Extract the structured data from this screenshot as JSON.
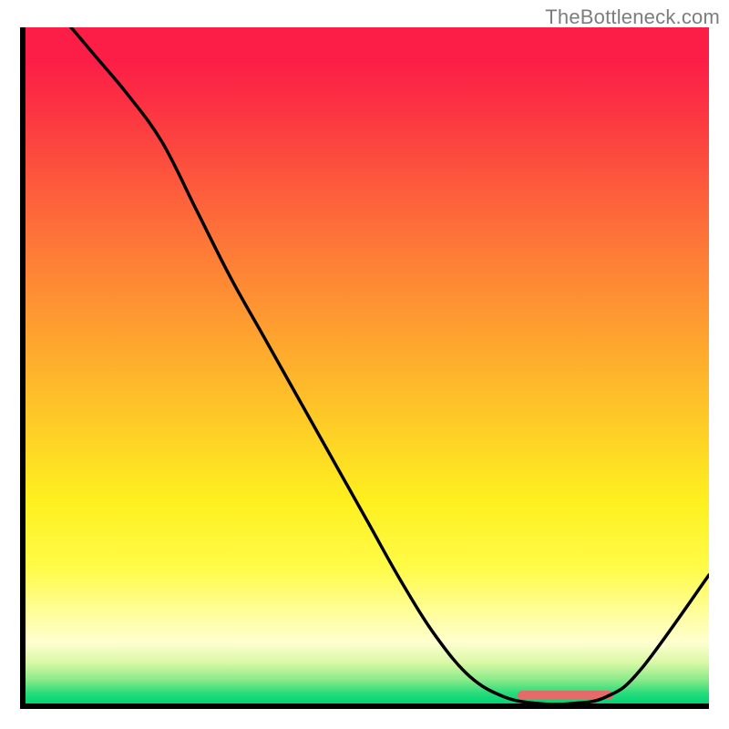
{
  "attribution": "TheBottleneck.com",
  "colors": {
    "axis": "#000000",
    "curve": "#000000",
    "marker": "#e56a6a",
    "gradient_top": "#fc1e47",
    "gradient_bottom": "#00d574"
  },
  "chart_data": {
    "type": "line",
    "title": "",
    "xlabel": "",
    "ylabel": "",
    "xlim": [
      0,
      100
    ],
    "ylim": [
      0,
      100
    ],
    "x": [
      0,
      5,
      10,
      15,
      20,
      25,
      30,
      35,
      40,
      45,
      50,
      55,
      60,
      65,
      70,
      75,
      80,
      85,
      90,
      100
    ],
    "values": [
      108,
      102,
      96,
      90,
      83,
      73,
      63,
      54,
      45,
      36,
      27,
      18,
      10,
      4,
      1,
      0,
      0,
      1,
      5,
      19
    ],
    "marker_range_x": [
      72,
      86
    ],
    "annotations": []
  }
}
